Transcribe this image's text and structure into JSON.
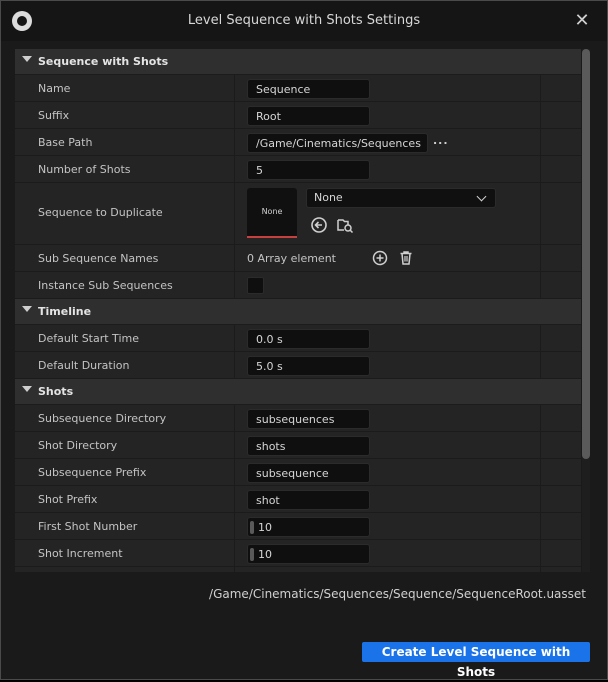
{
  "window": {
    "title": "Level Sequence with Shots Settings"
  },
  "sections": {
    "sequence": {
      "title": "Sequence with Shots",
      "rows": {
        "name": {
          "label": "Name",
          "value": "Sequence"
        },
        "suffix": {
          "label": "Suffix",
          "value": "Root"
        },
        "base_path": {
          "label": "Base Path",
          "value": "/Game/Cinematics/Sequences",
          "browse": "..."
        },
        "num_shots": {
          "label": "Number of Shots",
          "value": "5"
        },
        "duplicate": {
          "label": "Sequence to Duplicate",
          "thumbnail": "None",
          "combo_value": "None"
        },
        "sub_names": {
          "label": "Sub Sequence Names",
          "value": "0 Array element"
        },
        "instance": {
          "label": "Instance Sub Sequences",
          "checked": false
        }
      }
    },
    "timeline": {
      "title": "Timeline",
      "rows": {
        "start": {
          "label": "Default Start Time",
          "value": "0.0 s"
        },
        "duration": {
          "label": "Default Duration",
          "value": "5.0 s"
        }
      }
    },
    "shots": {
      "title": "Shots",
      "rows": {
        "subdir": {
          "label": "Subsequence Directory",
          "value": "subsequences"
        },
        "shotdir": {
          "label": "Shot Directory",
          "value": "shots"
        },
        "subprefix": {
          "label": "Subsequence Prefix",
          "value": "subsequence"
        },
        "shotprefix": {
          "label": "Shot Prefix",
          "value": "shot"
        },
        "first": {
          "label": "First Shot Number",
          "value": "10"
        },
        "increment": {
          "label": "Shot Increment",
          "value": "10"
        }
      }
    }
  },
  "footer": {
    "asset_path": "/Game/Cinematics/Sequences/Sequence/SequenceRoot.uasset",
    "create_label": "Create Level Sequence with Shots"
  },
  "icons": {
    "app": "unreal-engine-logo",
    "close": "close-icon",
    "browse": "ellipsis-icon",
    "use_selected": "use-selected-arrow-icon",
    "browse_asset": "browse-folder-icon",
    "add": "plus-circle-icon",
    "delete": "trash-icon",
    "dropdown": "chevron-down-icon"
  },
  "colors": {
    "accent": "#1a73e8",
    "panel": "#242424",
    "field": "#0f0f0f"
  }
}
